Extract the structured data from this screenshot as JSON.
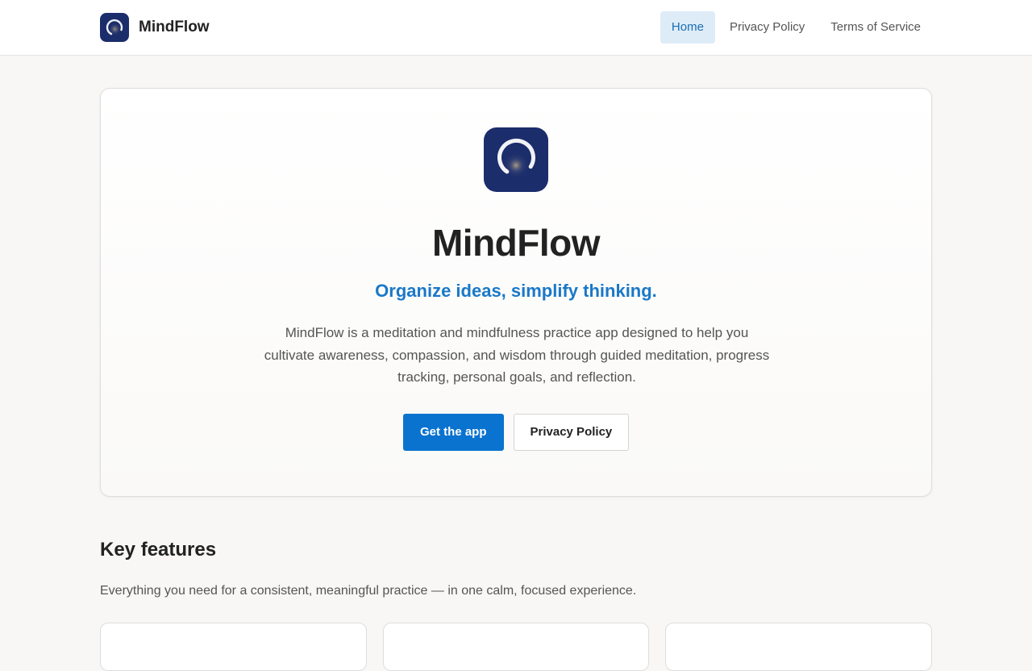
{
  "header": {
    "brand_name": "MindFlow",
    "nav": [
      {
        "label": "Home",
        "active": true
      },
      {
        "label": "Privacy Policy",
        "active": false
      },
      {
        "label": "Terms of Service",
        "active": false
      }
    ]
  },
  "hero": {
    "title": "MindFlow",
    "tagline": "Organize ideas, simplify thinking.",
    "description": "MindFlow is a meditation and mindfulness practice app designed to help you cultivate awareness, compassion, and wisdom through guided meditation, progress tracking, personal goals, and reflection.",
    "primary_button": "Get the app",
    "secondary_button": "Privacy Policy"
  },
  "features": {
    "title": "Key features",
    "description": "Everything you need for a consistent, meaningful practice — in one calm, focused experience."
  },
  "colors": {
    "accent": "#0a73cf",
    "tagline": "#1a78c8",
    "logo_bg": "#1b2d6b",
    "nav_active_bg": "#deecf8"
  },
  "icons": {
    "logo": "crescent-ring-icon"
  }
}
